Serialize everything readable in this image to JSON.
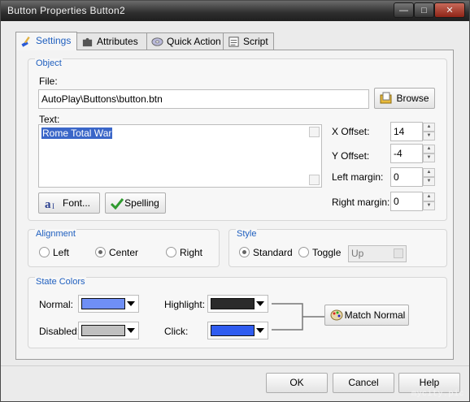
{
  "window": {
    "title": "Button Properties  Button2"
  },
  "titlebar": {
    "minimize": "—",
    "maximize": "□",
    "close": "✕"
  },
  "tabs": [
    {
      "label": "Settings",
      "icon": "brush-icon"
    },
    {
      "label": "Attributes",
      "icon": "puzzle-icon"
    },
    {
      "label": "Quick Action",
      "icon": "cd-icon"
    },
    {
      "label": "Script",
      "icon": "script-icon"
    }
  ],
  "object": {
    "group_title": "Object",
    "file_label": "File:",
    "file_value": "AutoPlay\\Buttons\\button.btn",
    "browse_label": "Browse",
    "text_label": "Text:",
    "text_value": "Rome Total War",
    "font_label": "Font...",
    "spelling_label": "Spelling",
    "x_offset_label": "X Offset:",
    "x_offset_value": "14",
    "y_offset_label": "Y Offset:",
    "y_offset_value": "-4",
    "left_margin_label": "Left margin:",
    "left_margin_value": "0",
    "right_margin_label": "Right margin:",
    "right_margin_value": "0"
  },
  "alignment": {
    "group_title": "Alignment",
    "options": [
      "Left",
      "Center",
      "Right"
    ],
    "selected": "Center"
  },
  "style": {
    "group_title": "Style",
    "options": [
      "Standard",
      "Toggle"
    ],
    "selected": "Standard",
    "toggle_state_value": "Up"
  },
  "state_colors": {
    "group_title": "State Colors",
    "normal_label": "Normal:",
    "normal_color": "#6f8ff5",
    "disabled_label": "Disabled:",
    "disabled_color": "#c0c0c0",
    "highlight_label": "Highlight:",
    "highlight_color": "#2b2b2b",
    "click_label": "Click:",
    "click_color": "#2f5cf0",
    "match_normal_label": "Match Normal"
  },
  "footer": {
    "ok_label": "OK",
    "cancel_label": "Cancel",
    "help_label": "Help"
  },
  "watermark": "mycity.pic"
}
